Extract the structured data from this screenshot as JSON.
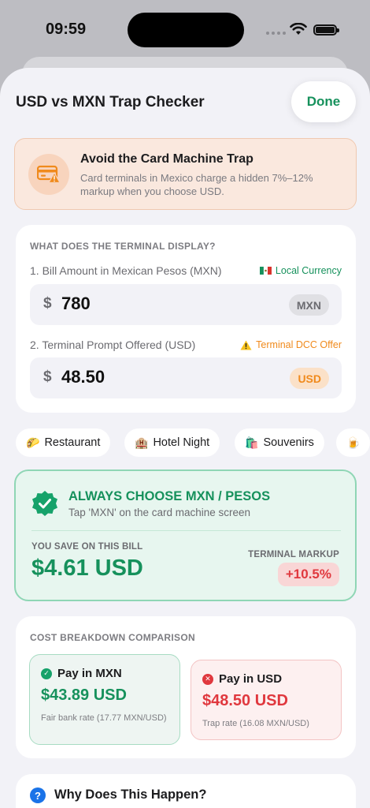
{
  "status_bar": {
    "time": "09:59"
  },
  "header": {
    "title": "USD vs MXN Trap Checker",
    "done_label": "Done"
  },
  "warning": {
    "title": "Avoid the Card Machine Trap",
    "text": "Card terminals in Mexico charge a hidden 7%–12% markup when you choose USD."
  },
  "input_card": {
    "heading": "WHAT DOES THE TERMINAL DISPLAY?",
    "bill": {
      "label": "1. Bill Amount in Mexican Pesos (MXN)",
      "tag": "Local Currency",
      "currency_symbol": "$",
      "value": "780",
      "currency": "MXN"
    },
    "prompt": {
      "label": "2. Terminal Prompt Offered (USD)",
      "tag": "Terminal DCC Offer",
      "currency_symbol": "$",
      "value": "48.50",
      "currency": "USD"
    }
  },
  "presets": [
    {
      "emoji": "🌮",
      "label": "Restaurant"
    },
    {
      "emoji": "🏨",
      "label": "Hotel Night"
    },
    {
      "emoji": "🛍️",
      "label": "Souvenirs"
    },
    {
      "emoji": "🍺",
      "label": ""
    }
  ],
  "result": {
    "title": "ALWAYS CHOOSE MXN / PESOS",
    "subtitle": "Tap 'MXN' on the card machine screen",
    "save_label": "YOU SAVE ON THIS BILL",
    "save_amount": "$4.61 USD",
    "markup_label": "TERMINAL MARKUP",
    "markup_value": "+10.5%"
  },
  "comparison": {
    "heading": "COST BREAKDOWN COMPARISON",
    "mxn": {
      "label": "Pay in MXN",
      "amount": "$43.89 USD",
      "note": "Fair bank rate (17.77 MXN/USD)"
    },
    "usd": {
      "label": "Pay in USD",
      "amount": "$48.50 USD",
      "note": "Trap rate (16.08 MXN/USD)"
    }
  },
  "why": {
    "title": "Why Does This Happen?"
  },
  "colors": {
    "accent_green": "#16915c",
    "warning_orange": "#f08a1c",
    "danger_red": "#e0383e",
    "info_blue": "#1a73e8"
  }
}
